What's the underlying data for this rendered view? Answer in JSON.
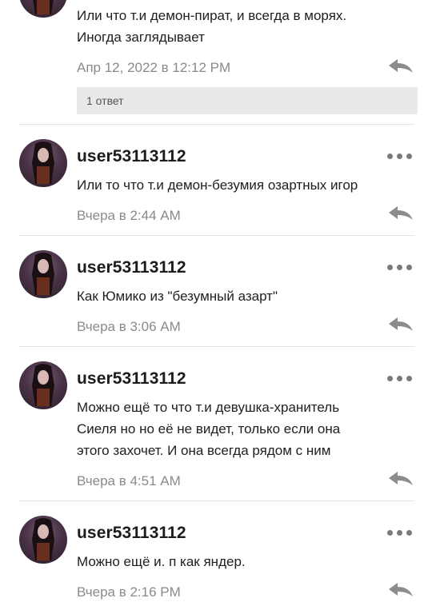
{
  "icons": {
    "more": "more-horizontal-icon",
    "reply": "reply-arrow-icon",
    "avatar": "user-avatar-icon"
  },
  "colors": {
    "text": "#202020",
    "username": "#1c1c1c",
    "timestamp": "#8a8a8a",
    "icon": "#7a7a7a",
    "replies_bar": "#e9e9e9",
    "divider": "#e4e4e4"
  },
  "first_comment": {
    "text_lines": [
      "Или что т.и демон-пират, и всегда в морях.",
      "Иногда заглядывает"
    ],
    "time": "Апр 12, 2022 в 12:12 PM",
    "replies_label": "1 ответ"
  },
  "comments": [
    {
      "username": "user53113112",
      "text_lines": [
        "Или то что т.и демон-безумия озартных игор"
      ],
      "time": "Вчера в 2:44 AM"
    },
    {
      "username": "user53113112",
      "text_lines": [
        "Как Юмико из \"безумный азарт\""
      ],
      "time": "Вчера в 3:06 AM"
    },
    {
      "username": "user53113112",
      "text_lines": [
        "Можно ещё то что т.и девушка-хранитель",
        "Сиеля но но её не видет, только если она",
        "этого захочет. И она всегда рядом с ним"
      ],
      "time": "Вчера в 4:51 AM"
    },
    {
      "username": "user53113112",
      "text_lines": [
        "Можно ещё и. п как яндер."
      ],
      "time": "Вчера в 2:16 PM"
    }
  ]
}
